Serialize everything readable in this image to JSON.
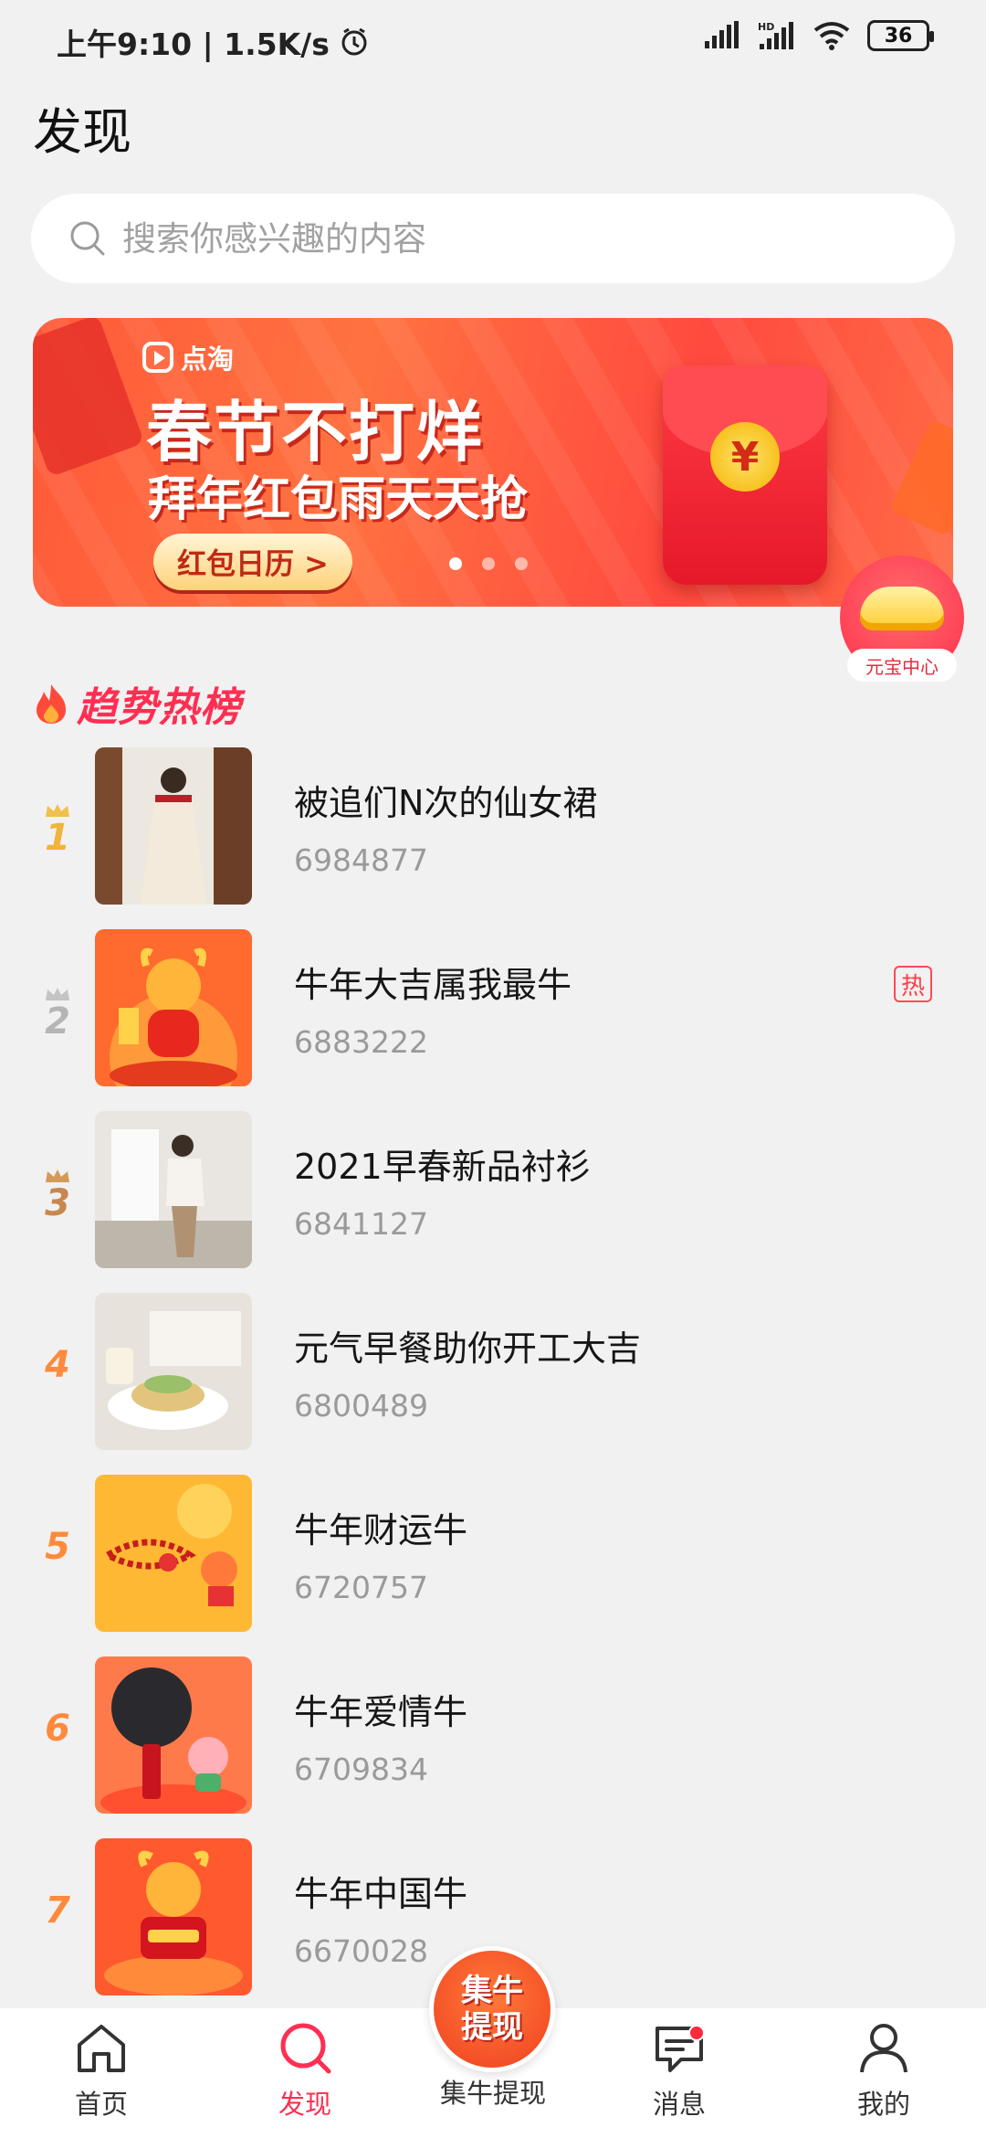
{
  "status_bar": {
    "time_speed": "上午9:10 | 1.5K/s",
    "battery": "36"
  },
  "header": {
    "title": "发现"
  },
  "search": {
    "placeholder": "搜索你感兴趣的内容"
  },
  "banner": {
    "brand": "点淘",
    "line1": "春节不打烊",
    "line2": "拜年红包雨天天抢",
    "button": "红包日历 >",
    "coin": "¥"
  },
  "floating_badge": {
    "label": "元宝中心"
  },
  "trending": {
    "title": "趋势热榜",
    "hot_label": "热",
    "items": [
      {
        "rank": "1",
        "title": "被追们N次的仙女裙",
        "count": "6984877"
      },
      {
        "rank": "2",
        "title": "牛年大吉属我最牛",
        "count": "6883222"
      },
      {
        "rank": "3",
        "title": "2021早春新品衬衫",
        "count": "6841127"
      },
      {
        "rank": "4",
        "title": "元气早餐助你开工大吉",
        "count": "6800489"
      },
      {
        "rank": "5",
        "title": "牛年财运牛",
        "count": "6720757"
      },
      {
        "rank": "6",
        "title": "牛年爱情牛",
        "count": "6709834"
      },
      {
        "rank": "7",
        "title": "牛年中国牛",
        "count": "6670028"
      }
    ]
  },
  "bottom_nav": {
    "home": "首页",
    "discover": "发现",
    "center": "集牛提现",
    "center_badge": "集牛\n提现",
    "messages": "消息",
    "mine": "我的"
  },
  "colors": {
    "accent": "#ff2e52",
    "rank_orange": "#ff8a3c",
    "banner": "#ff5a39"
  }
}
